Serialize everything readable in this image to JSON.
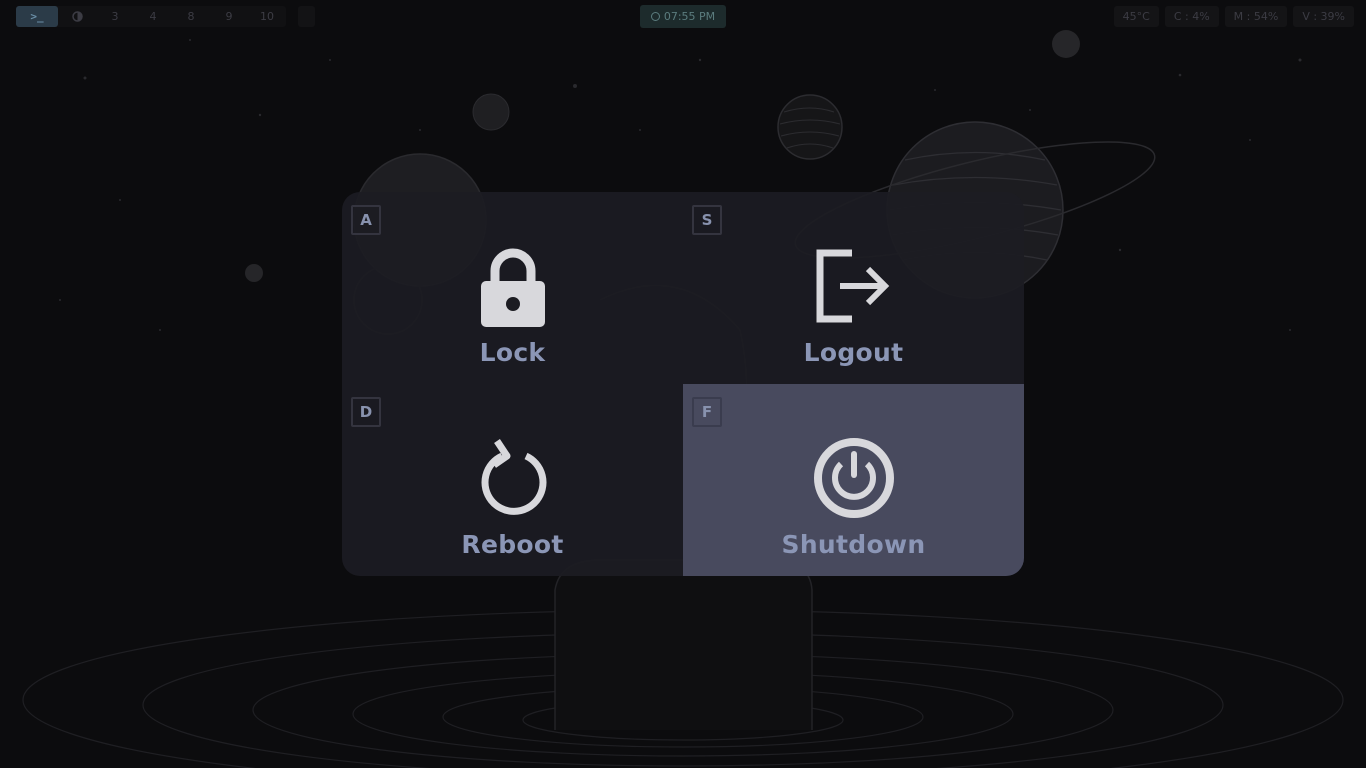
{
  "topbar": {
    "terminal_label": ">_",
    "workspaces": [
      "3",
      "4",
      "8",
      "9",
      "10"
    ],
    "clock": "07:55 PM",
    "stats": {
      "temperature": "45°C",
      "cpu": "C : 4%",
      "memory": "M : 54%",
      "volume": "V : 39%"
    }
  },
  "power_menu": {
    "options": [
      {
        "key": "A",
        "label": "Lock",
        "icon": "lock-icon"
      },
      {
        "key": "S",
        "label": "Logout",
        "icon": "logout-icon"
      },
      {
        "key": "D",
        "label": "Reboot",
        "icon": "reboot-icon"
      },
      {
        "key": "F",
        "label": "Shutdown",
        "icon": "power-icon"
      }
    ],
    "selected": "Shutdown"
  },
  "colors": {
    "background": "#0c0c0e",
    "menu_background": "#1c1c22",
    "selected_tile": "#484a5e",
    "label_text": "#8b96b6",
    "icon": "#d8d8dc"
  }
}
